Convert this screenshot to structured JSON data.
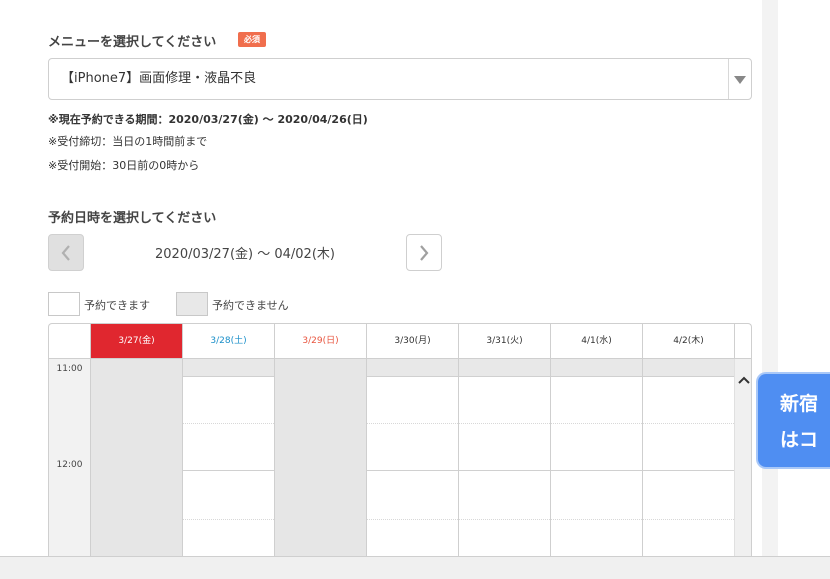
{
  "menu": {
    "label": "メニューを選択してください",
    "required_badge": "必須",
    "selected": "【iPhone7】画面修理・液晶不良"
  },
  "notes": {
    "period": "※現在予約できる期間：2020/03/27(金) 〜 2020/04/26(日)",
    "deadline": "※受付締切：当日の1時間前まで",
    "start": "※受付開始：30日前の0時から"
  },
  "datetime": {
    "label": "予約日時を選択してください",
    "range": "2020/03/27(金) 〜 04/02(木)",
    "prev_icon": "chevron-left-icon",
    "next_icon": "chevron-right-icon"
  },
  "legend": {
    "available": "予約できます",
    "unavailable": "予約できません"
  },
  "calendar": {
    "days": [
      {
        "label": "3/27(金)",
        "kind": "today"
      },
      {
        "label": "3/28(土)",
        "kind": "sat"
      },
      {
        "label": "3/29(日)",
        "kind": "sun"
      },
      {
        "label": "3/30(月)",
        "kind": "weekday"
      },
      {
        "label": "3/31(火)",
        "kind": "weekday"
      },
      {
        "label": "4/1(水)",
        "kind": "weekday"
      },
      {
        "label": "4/2(木)",
        "kind": "weekday"
      }
    ],
    "times": [
      "11:00",
      "12:00"
    ]
  },
  "banner": {
    "line1": "新宿",
    "line2": "はコ"
  },
  "colors": {
    "today": "#e0272f",
    "saturday": "#1a8fc9",
    "sunday": "#e8553f",
    "badge": "#f06e4d",
    "banner": "#4f8ef2"
  }
}
